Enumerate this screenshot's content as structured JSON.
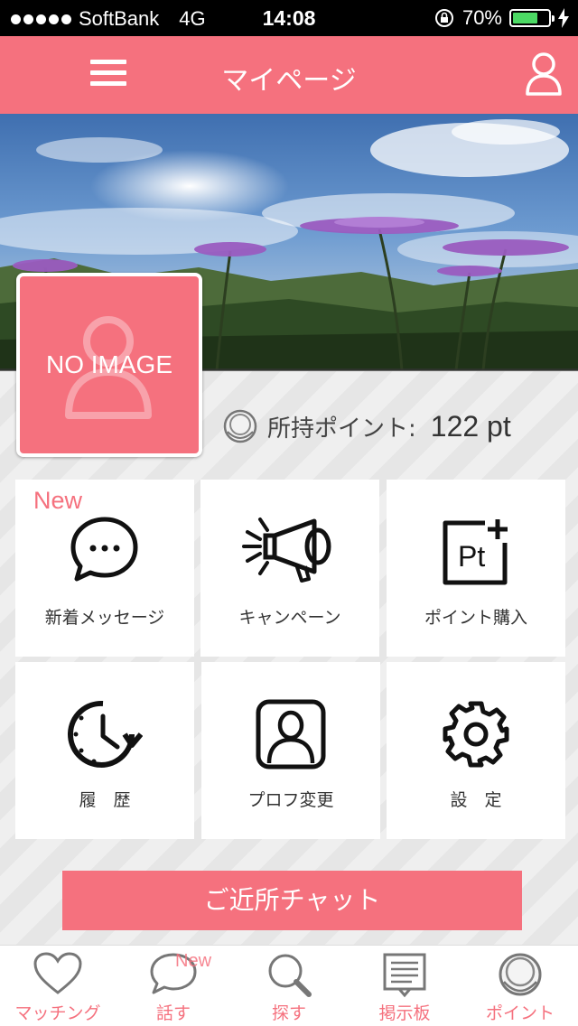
{
  "status_bar": {
    "carrier": "SoftBank",
    "network": "4G",
    "time": "14:08",
    "battery_text": "70%",
    "battery_level": 0.7
  },
  "header": {
    "title": "マイページ",
    "menu_icon": "hamburger-menu-icon",
    "account_icon": "user-icon"
  },
  "profile": {
    "no_image_label": "NO IMAGE",
    "points_label": "所持ポイント:",
    "points_value": "122 pt"
  },
  "menu": {
    "new_badge": "New",
    "items": [
      {
        "label": "新着メッセージ",
        "icon": "chat-bubble-icon"
      },
      {
        "label": "キャンペーン",
        "icon": "megaphone-icon"
      },
      {
        "label": "ポイント購入",
        "icon": "point-purchase-icon"
      },
      {
        "label": "履　歴",
        "icon": "history-clock-icon"
      },
      {
        "label": "プロフ変更",
        "icon": "profile-edit-icon"
      },
      {
        "label": "設　定",
        "icon": "gear-icon"
      }
    ]
  },
  "chat_button": {
    "label": "ご近所チャット"
  },
  "tab_bar": {
    "new_badge": "New",
    "tabs": [
      {
        "label": "マッチング",
        "icon": "heart-icon"
      },
      {
        "label": "話す",
        "icon": "speech-bubble-icon"
      },
      {
        "label": "探す",
        "icon": "search-icon"
      },
      {
        "label": "掲示板",
        "icon": "bulletin-board-icon"
      },
      {
        "label": "ポイント",
        "icon": "coin-icon"
      }
    ]
  },
  "colors": {
    "accent": "#f5717e",
    "status_bar": "#000000",
    "battery": "#4cd964"
  }
}
